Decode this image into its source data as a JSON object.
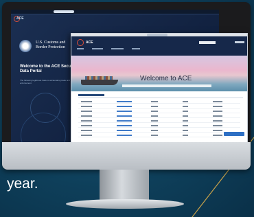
{
  "caption": "year.",
  "back_screen": {
    "app_label": "ACE",
    "agency_line1": "U.S. Customs and",
    "agency_line2": "Border Protection",
    "welcome_title": "Welcome to the ACE Secure Data Portal",
    "welcome_subtitle": "The following legitimate trade to accelerating trade and enforcement"
  },
  "front_screen": {
    "app_label": "ACE",
    "hero_title": "Welcome to ACE",
    "table_rows": 8
  },
  "colors": {
    "background": "#0e3f5a",
    "accent_gold": "#c9a24a",
    "nav": "#16284a",
    "link": "#3f7ac8"
  }
}
